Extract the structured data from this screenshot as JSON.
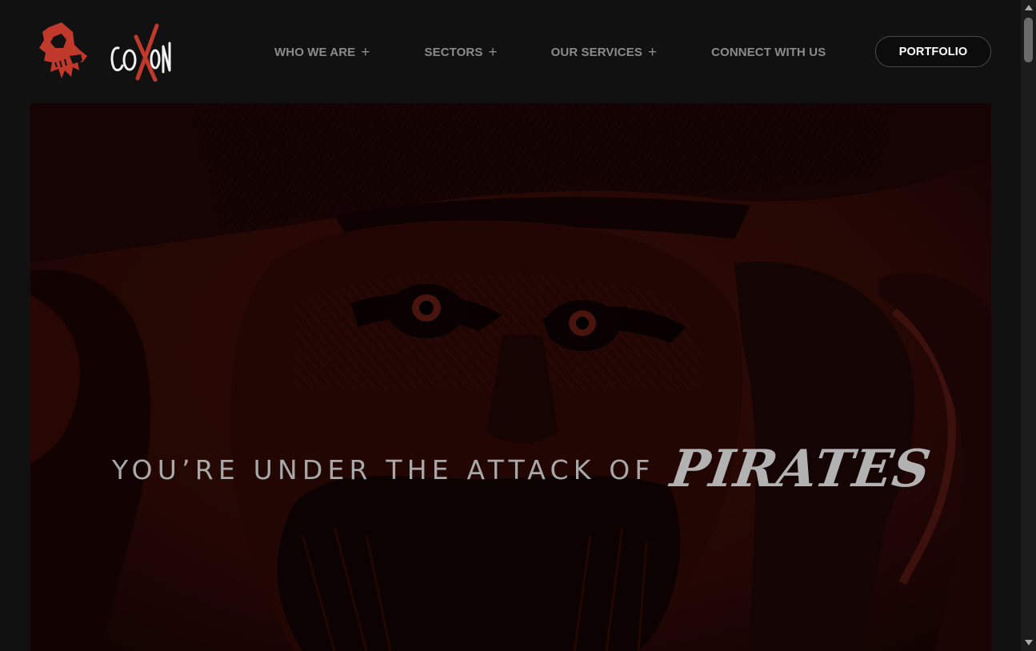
{
  "brand": {
    "logo_text": "COXON",
    "accent_color": "#c0392b"
  },
  "nav": {
    "items": [
      {
        "label": "WHO WE ARE",
        "icon": "plus-icon"
      },
      {
        "label": "SECTORS",
        "icon": "plus-icon"
      },
      {
        "label": "OUR SERVICES",
        "icon": "plus-icon"
      },
      {
        "label": "CONNECT WITH US"
      }
    ],
    "portfolio_label": "PORTFOLIO"
  },
  "hero": {
    "lead": "YOU’RE UNDER THE ATTACK OF",
    "strong": "PIRATES",
    "image_tone": "#3a0d09"
  }
}
